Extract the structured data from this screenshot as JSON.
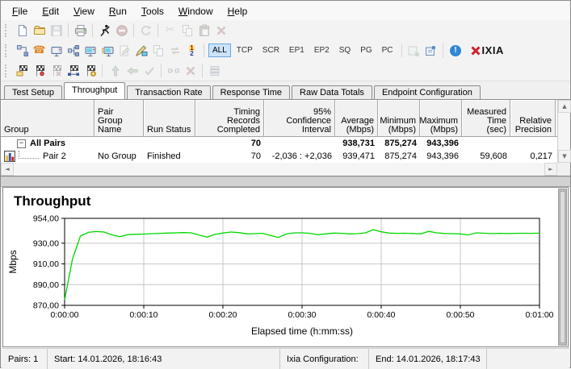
{
  "menu": {
    "items": [
      {
        "label": "File",
        "u": 0
      },
      {
        "label": "Edit",
        "u": 0
      },
      {
        "label": "View",
        "u": 0
      },
      {
        "label": "Run",
        "u": 0
      },
      {
        "label": "Tools",
        "u": 0
      },
      {
        "label": "Window",
        "u": 0
      },
      {
        "label": "Help",
        "u": 0
      }
    ]
  },
  "toolbars": {
    "row1": [
      {
        "name": "new-test-icon",
        "glyph": "page"
      },
      {
        "name": "open-test-icon",
        "glyph": "folder"
      },
      {
        "name": "save-test-icon",
        "glyph": "disk",
        "disabled": true
      },
      {
        "sep": true
      },
      {
        "name": "print-icon",
        "glyph": "printer"
      },
      {
        "sep": true
      },
      {
        "name": "run-test-icon",
        "glyph": "runner"
      },
      {
        "name": "stop-test-icon",
        "glyph": "stop",
        "disabled": true
      },
      {
        "sep": true
      },
      {
        "name": "refresh-icon",
        "glyph": "refresh",
        "disabled": true
      },
      {
        "sep": true
      },
      {
        "name": "cut-icon",
        "glyph": "scissors",
        "disabled": true
      },
      {
        "name": "copy-icon",
        "glyph": "copy",
        "disabled": true
      },
      {
        "name": "paste-icon",
        "glyph": "paste",
        "disabled": true
      },
      {
        "name": "delete-icon",
        "glyph": "xred",
        "disabled": true
      }
    ],
    "row2": [
      {
        "name": "add-pair-icon",
        "glyph": "pair"
      },
      {
        "name": "add-voip-pair-icon",
        "glyph": "phone"
      },
      {
        "name": "add-video-pair-icon",
        "glyph": "tvgrey"
      },
      {
        "name": "add-multicast-group-icon",
        "glyph": "multicast"
      },
      {
        "name": "add-hardware-video-pair-icon",
        "glyph": "tvcolor"
      },
      {
        "name": "add-video-stream-icon",
        "glyph": "tvfast"
      },
      {
        "name": "edit-pair-icon",
        "glyph": "editdoc",
        "disabled": true
      },
      {
        "name": "edit-ixia-config-icon",
        "glyph": "pentv"
      },
      {
        "name": "duplicate-pair-icon",
        "glyph": "copy",
        "disabled": true
      },
      {
        "name": "swap-endpoints-icon",
        "glyph": "swap",
        "disabled": true
      },
      {
        "name": "set-run-order-icon",
        "glyph": "num12"
      },
      {
        "sep": true
      },
      {
        "name": "filter-all-button",
        "button": true,
        "label": "ALL",
        "active": true
      },
      {
        "name": "filter-tcp-button",
        "button": true,
        "label": "TCP"
      },
      {
        "name": "filter-scr-button",
        "button": true,
        "label": "SCR"
      },
      {
        "name": "filter-ep1-button",
        "button": true,
        "label": "EP1"
      },
      {
        "name": "filter-ep2-button",
        "button": true,
        "label": "EP2"
      },
      {
        "name": "filter-sq-button",
        "button": true,
        "label": "SQ"
      },
      {
        "name": "filter-pg-button",
        "button": true,
        "label": "PG"
      },
      {
        "name": "filter-pc-button",
        "button": true,
        "label": "PC"
      },
      {
        "sep": true
      },
      {
        "name": "import-test-icon",
        "glyph": "importwin",
        "disabled": true
      },
      {
        "name": "export-test-icon",
        "glyph": "exportwin"
      },
      {
        "sep": true,
        "dotted": true
      },
      {
        "name": "info-icon",
        "glyph": "info"
      },
      {
        "name": "ixia-logo",
        "logo": true,
        "label": "IXIA"
      }
    ],
    "row3": [
      {
        "name": "open-results-icon",
        "glyph": "flagfolder"
      },
      {
        "name": "mark-results-icon",
        "glyph": "flagpin"
      },
      {
        "name": "discard-results-icon",
        "glyph": "flagx",
        "disabled": true
      },
      {
        "name": "compare-results-icon",
        "glyph": "flagnet"
      },
      {
        "name": "poll-endpoints-icon",
        "glyph": "flagdial"
      },
      {
        "sep": true,
        "dotted": true
      },
      {
        "name": "move-up-icon",
        "glyph": "upgreen",
        "disabled": true
      },
      {
        "name": "move-back-icon",
        "glyph": "backgreen",
        "disabled": true
      },
      {
        "name": "apply-icon",
        "glyph": "checkgreen",
        "disabled": true
      },
      {
        "sep": true
      },
      {
        "name": "link-pairs-icon",
        "glyph": "pairdash",
        "disabled": true
      },
      {
        "name": "unlink-pairs-icon",
        "glyph": "xred",
        "disabled": true
      },
      {
        "sep": true
      },
      {
        "name": "group-pairs-icon",
        "glyph": "stack",
        "disabled": true
      }
    ]
  },
  "tabs": {
    "active_index": 1,
    "items": [
      "Test Setup",
      "Throughput",
      "Transaction Rate",
      "Response Time",
      "Raw Data Totals",
      "Endpoint Configuration"
    ]
  },
  "table": {
    "columns": [
      {
        "key": "group",
        "label": "Group",
        "width": 116,
        "align": "left"
      },
      {
        "key": "pair_group_name",
        "label": "Pair Group\nName",
        "width": 61,
        "align": "left"
      },
      {
        "key": "run_status",
        "label": "Run Status",
        "width": 64,
        "align": "left"
      },
      {
        "key": "timing_records",
        "label": "Timing Records\nCompleted",
        "width": 85,
        "align": "right"
      },
      {
        "key": "confidence",
        "label": "95% Confidence\nInterval",
        "width": 88,
        "align": "right"
      },
      {
        "key": "avg",
        "label": "Average\n(Mbps)",
        "width": 53,
        "align": "right"
      },
      {
        "key": "min",
        "label": "Minimum\n(Mbps)",
        "width": 52,
        "align": "right"
      },
      {
        "key": "max",
        "label": "Maximum\n(Mbps)",
        "width": 52,
        "align": "right"
      },
      {
        "key": "time",
        "label": "Measured\nTime (sec)",
        "width": 60,
        "align": "right"
      },
      {
        "key": "precision",
        "label": "Relative\nPrecision",
        "width": 56,
        "align": "right"
      }
    ],
    "rows": [
      {
        "type": "group",
        "name": "row-all-pairs",
        "label": "All Pairs",
        "bold": true,
        "values": {
          "timing_records": "70",
          "avg": "938,731",
          "min": "875,274",
          "max": "943,396"
        }
      },
      {
        "type": "pair",
        "name": "row-pair-2",
        "label": "Pair 2",
        "values": {
          "pair_group_name": "No Group",
          "run_status": "Finished",
          "timing_records": "70",
          "confidence": "-2,036 : +2,036",
          "avg": "939,471",
          "min": "875,274",
          "max": "943,396",
          "time": "59,608",
          "precision": "0,217"
        }
      }
    ]
  },
  "chart_data": {
    "type": "line",
    "title": "Throughput",
    "xlabel": "Elapsed time (h:mm:ss)",
    "ylabel": "Mbps",
    "ylim": [
      870,
      954
    ],
    "x_range_seconds": [
      0,
      60
    ],
    "sample_interval_sec": 1,
    "grid": true,
    "line_color": "#00d800",
    "grid_color": "#c6c6c6",
    "yticks": [
      {
        "v": 870,
        "label": "870,00"
      },
      {
        "v": 890,
        "label": "890,00"
      },
      {
        "v": 910,
        "label": "910,00"
      },
      {
        "v": 930,
        "label": "930,00"
      },
      {
        "v": 954,
        "label": "954,00"
      }
    ],
    "xticks": [
      {
        "t": 0,
        "label": "0:00:00"
      },
      {
        "t": 10,
        "label": "0:00:10"
      },
      {
        "t": 20,
        "label": "0:00:20"
      },
      {
        "t": 30,
        "label": "0:00:30"
      },
      {
        "t": 40,
        "label": "0:00:40"
      },
      {
        "t": 50,
        "label": "0:00:50"
      },
      {
        "t": 60,
        "label": "0:01:00"
      }
    ],
    "series": [
      {
        "name": "Pair 2",
        "values": [
          875.3,
          915,
          937,
          940.5,
          941.3,
          940.8,
          938,
          936.3,
          938.3,
          938.6,
          938.8,
          939.2,
          939.5,
          939.8,
          940,
          940.2,
          940,
          937.8,
          935.8,
          938.5,
          939.8,
          940.8,
          940.2,
          939,
          939.2,
          939.6,
          937.5,
          935.6,
          938.8,
          940,
          940,
          939.5,
          938.2,
          939,
          939.8,
          939.5,
          939,
          939.2,
          940,
          943,
          941,
          939.8,
          939.5,
          939.6,
          939.4,
          939,
          941.5,
          940,
          939.4,
          939.2,
          939,
          938,
          940,
          939.6,
          939.3,
          939.5,
          939.4,
          939.5,
          939.6,
          939.5,
          939.7
        ]
      }
    ],
    "summary": {
      "average_mbps": "939,471",
      "minimum_mbps": "875,274",
      "maximum_mbps": "943,396"
    }
  },
  "status_bar": {
    "pairs": "Pairs: 1",
    "start": "Start: 14.01.2026, 18:16:43",
    "config": "Ixia Configuration:",
    "end": "End: 14.01.2026, 18:17:43"
  }
}
